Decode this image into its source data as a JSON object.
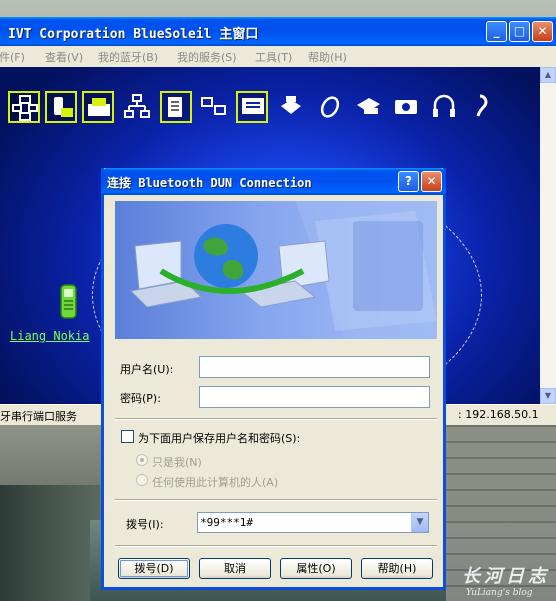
{
  "main_window": {
    "title": "IVT Corporation BlueSoleil 主窗口",
    "menu": [
      "文件(F)",
      "查看(V)",
      "我的蓝牙(B)",
      "我的服务(S)",
      "工具(T)",
      "帮助(H)"
    ],
    "device_label": "Liang Nokia",
    "status_left": "牙串行端口服务",
    "status_right": ": 192.168.50.1",
    "icons": [
      "network-icon",
      "phone-sync-icon",
      "fax-icon",
      "lan-icon",
      "file-transfer-icon",
      "pan-icon",
      "dun-icon",
      "printer-icon",
      "mouse-icon",
      "fax-machine-icon",
      "camera-icon",
      "headphones-icon",
      "headset-icon"
    ]
  },
  "dialog": {
    "title": "连接 Bluetooth DUN Connection",
    "username_label": "用户名(U):",
    "password_label": "密码(P):",
    "username_value": "",
    "password_value": "",
    "save_checkbox_label": "为下面用户保存用户名和密码(S):",
    "radio_me_only": "只是我(N)",
    "radio_anyone": "任何使用此计算机的人(A)",
    "dial_label": "拨号(I):",
    "dial_value": "*99***1#",
    "buttons": {
      "dial": "拨号(D)",
      "cancel": "取消",
      "properties": "属性(O)",
      "help": "帮助(H)"
    }
  },
  "watermark": {
    "main": "长河日志",
    "sub": "YuLiang's blog"
  },
  "colors": {
    "xp_title_blue": "#0053ee",
    "canvas_blue": "#173fe0",
    "device_label_green": "#7cff5b"
  }
}
